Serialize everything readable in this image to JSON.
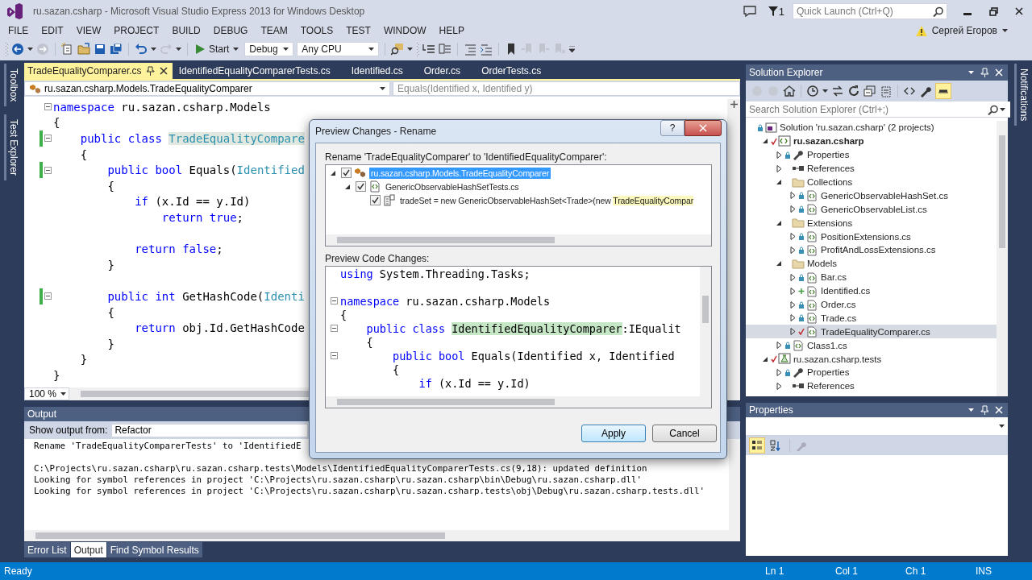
{
  "window": {
    "title": "ru.sazan.csharp - Microsoft Visual Studio Express 2013 for Windows Desktop"
  },
  "title_bar": {
    "notification_count": "1",
    "quick_launch": {
      "placeholder": "Quick Launch (Ctrl+Q)"
    },
    "user": "Сергей Егоров"
  },
  "menu": [
    "FILE",
    "EDIT",
    "VIEW",
    "PROJECT",
    "BUILD",
    "DEBUG",
    "TEAM",
    "TOOLS",
    "TEST",
    "WINDOW",
    "HELP"
  ],
  "toolbar": {
    "start": "Start",
    "configuration": "Debug",
    "platform": "Any CPU"
  },
  "side_tabs": [
    "Toolbox",
    "Test Explorer"
  ],
  "editor": {
    "tabs": [
      {
        "label": "TradeEqualityComparer.cs",
        "selected": true
      },
      {
        "label": "IdentifiedEqualityComparerTests.cs",
        "selected": false
      },
      {
        "label": "Identified.cs",
        "selected": false
      },
      {
        "label": "Order.cs",
        "selected": false
      },
      {
        "label": "OrderTests.cs",
        "selected": false
      }
    ],
    "nav_type": "ru.sazan.csharp.Models.TradeEqualityComparer",
    "nav_member": "Equals(Identified x, Identified y)",
    "lines": [
      {
        "segments": [
          {
            "kind": "keyword",
            "text": "namespace"
          },
          {
            "kind": "plain",
            "text": " ru.sazan.csharp.Models"
          }
        ],
        "collapsible": true,
        "changed": false
      },
      {
        "segments": [
          {
            "kind": "plain",
            "text": "{"
          }
        ],
        "collapsible": false,
        "changed": false
      },
      {
        "segments": [
          {
            "kind": "keyword",
            "text": "    public class "
          },
          {
            "kind": "rename",
            "text": "TradeEqualityCompare"
          }
        ],
        "collapsible": true,
        "changed": true
      },
      {
        "segments": [
          {
            "kind": "plain",
            "text": "    {"
          }
        ],
        "collapsible": false,
        "changed": false
      },
      {
        "segments": [
          {
            "kind": "keyword",
            "text": "        public bool"
          },
          {
            "kind": "plain",
            "text": " Equals("
          },
          {
            "kind": "type",
            "text": "Identified"
          }
        ],
        "collapsible": true,
        "changed": true
      },
      {
        "segments": [
          {
            "kind": "plain",
            "text": "        {"
          }
        ],
        "collapsible": false,
        "changed": false
      },
      {
        "segments": [
          {
            "kind": "keyword",
            "text": "            if"
          },
          {
            "kind": "plain",
            "text": " (x.Id == y.Id)"
          }
        ],
        "collapsible": false,
        "changed": false
      },
      {
        "segments": [
          {
            "kind": "keyword",
            "text": "                return true"
          },
          {
            "kind": "plain",
            "text": ";"
          }
        ],
        "collapsible": false,
        "changed": false
      },
      {
        "segments": [
          {
            "kind": "keyword",
            "text": "            return false"
          },
          {
            "kind": "plain",
            "text": ";"
          }
        ],
        "collapsible": false,
        "changed": false,
        "blank_before": true
      },
      {
        "segments": [
          {
            "kind": "plain",
            "text": "        }"
          }
        ],
        "collapsible": false,
        "changed": false
      },
      {
        "segments": [
          {
            "kind": "keyword",
            "text": "        public int"
          },
          {
            "kind": "plain",
            "text": " GetHashCode("
          },
          {
            "kind": "type",
            "text": "Identi"
          }
        ],
        "collapsible": true,
        "changed": true,
        "blank_before": true
      },
      {
        "segments": [
          {
            "kind": "plain",
            "text": "        {"
          }
        ],
        "collapsible": false,
        "changed": false
      },
      {
        "segments": [
          {
            "kind": "keyword",
            "text": "            return"
          },
          {
            "kind": "plain",
            "text": " obj.Id.GetHashCode"
          }
        ],
        "collapsible": false,
        "changed": false
      },
      {
        "segments": [
          {
            "kind": "plain",
            "text": "        }"
          }
        ],
        "collapsible": false,
        "changed": false
      },
      {
        "segments": [
          {
            "kind": "plain",
            "text": "    }"
          }
        ],
        "collapsible": false,
        "changed": false
      },
      {
        "segments": [
          {
            "kind": "plain",
            "text": "}"
          }
        ],
        "collapsible": false,
        "changed": false
      }
    ],
    "zoom": "100 %"
  },
  "dialog": {
    "title": "Preview Changes - Rename",
    "help_button": "?",
    "rename_label": "Rename 'TradeEqualityComparer' to 'IdentifiedEqualityComparer':",
    "tree": [
      {
        "label": "ru.sazan.csharp.Models.TradeEqualityComparer",
        "kind": "class",
        "checked": true,
        "expanded": true,
        "selected": true,
        "children": [
          {
            "label": "GenericObservableHashSetTests.cs",
            "kind": "file",
            "checked": true,
            "expanded": true,
            "selected": false,
            "children": [
              {
                "label": "tradeSet = new GenericObservableHashSet<Trade>(new ",
                "match": "TradeEqualityCompar",
                "kind": "reference",
                "checked": true,
                "selected": false
              }
            ]
          }
        ]
      }
    ],
    "preview_label": "Preview Code Changes:",
    "preview_lines": [
      {
        "segments": [
          {
            "kind": "keyword",
            "text": "using"
          },
          {
            "kind": "plain",
            "text": " System.Threading.Tasks;"
          }
        ],
        "collapsible": false
      },
      {
        "segments": [
          {
            "kind": "keyword",
            "text": "namespace"
          },
          {
            "kind": "plain",
            "text": " ru.sazan.csharp.Models"
          }
        ],
        "collapsible": true,
        "blank_before": true
      },
      {
        "segments": [
          {
            "kind": "plain",
            "text": "{"
          }
        ],
        "collapsible": false
      },
      {
        "segments": [
          {
            "kind": "keyword",
            "text": "    public class "
          },
          {
            "kind": "added",
            "text": "IdentifiedEqualityComparer"
          },
          {
            "kind": "plain",
            "text": ":IEqualit"
          }
        ],
        "collapsible": true
      },
      {
        "segments": [
          {
            "kind": "plain",
            "text": "    {"
          }
        ],
        "collapsible": false
      },
      {
        "segments": [
          {
            "kind": "keyword",
            "text": "        public bool"
          },
          {
            "kind": "plain",
            "text": " Equals(Identified x, Identified"
          }
        ],
        "collapsible": true
      },
      {
        "segments": [
          {
            "kind": "plain",
            "text": "        {"
          }
        ],
        "collapsible": false
      },
      {
        "segments": [
          {
            "kind": "keyword",
            "text": "            if"
          },
          {
            "kind": "plain",
            "text": " (x.Id == y.Id)"
          }
        ],
        "collapsible": false
      }
    ],
    "buttons": [
      {
        "label": "Apply",
        "default": true
      },
      {
        "label": "Cancel",
        "default": false
      }
    ]
  },
  "output": {
    "title": "Output",
    "source_label": "Show output from:",
    "source": "Refactor",
    "lines": [
      "Rename 'TradeEqualityComparerTests' to 'IdentifiedE",
      "C:\\Projects\\ru.sazan.csharp\\ru.sazan.csharp.tests\\Models\\IdentifiedEqualityComparerTests.cs(9,18): updated definition",
      "Looking for symbol references in project 'C:\\Projects\\ru.sazan.csharp\\ru.sazan.csharp\\bin\\Debug\\ru.sazan.csharp.dll'",
      "Looking for symbol references in project 'C:\\Projects\\ru.sazan.csharp\\ru.sazan.csharp.tests\\obj\\Debug\\ru.sazan.csharp.tests.dll'"
    ],
    "tabs": [
      {
        "label": "Error List",
        "selected": false
      },
      {
        "label": "Output",
        "selected": true
      },
      {
        "label": "Find Symbol Results",
        "selected": false
      }
    ]
  },
  "solution_explorer": {
    "title": "Solution Explorer",
    "preview_selected": true,
    "search": {
      "placeholder": "Search Solution Explorer (Ctrl+;)"
    },
    "tree": [
      {
        "label": "Solution 'ru.sazan.csharp' (2 projects)",
        "kind": "solution",
        "checked_in": true,
        "added": false,
        "modified": false,
        "selected": false,
        "children": [
          {
            "label": "ru.sazan.csharp",
            "kind": "project",
            "checked_in": false,
            "added": false,
            "modified": true,
            "startup": true,
            "expanded": true,
            "selected": false,
            "children": [
              {
                "label": "Properties",
                "kind": "properties",
                "checked_in": true,
                "added": false,
                "modified": false,
                "expanded": false,
                "selected": false
              },
              {
                "label": "References",
                "kind": "references",
                "checked_in": false,
                "added": false,
                "modified": false,
                "expanded": false,
                "selected": false
              },
              {
                "label": "Collections",
                "kind": "folder",
                "checked_in": false,
                "added": false,
                "modified": false,
                "expanded": true,
                "selected": false,
                "children": [
                  {
                    "label": "GenericObservableHashSet.cs",
                    "kind": "csharp",
                    "checked_in": true,
                    "added": false,
                    "modified": false,
                    "expanded": false,
                    "selected": false
                  },
                  {
                    "label": "GenericObservableList.cs",
                    "kind": "csharp",
                    "checked_in": true,
                    "added": false,
                    "modified": false,
                    "expanded": false,
                    "selected": false
                  }
                ]
              },
              {
                "label": "Extensions",
                "kind": "folder",
                "checked_in": false,
                "added": false,
                "modified": false,
                "expanded": true,
                "selected": false,
                "children": [
                  {
                    "label": "PositionExtensions.cs",
                    "kind": "csharp",
                    "checked_in": true,
                    "added": false,
                    "modified": false,
                    "expanded": false,
                    "selected": false
                  },
                  {
                    "label": "ProfitAndLossExtensions.cs",
                    "kind": "csharp",
                    "checked_in": true,
                    "added": false,
                    "modified": false,
                    "expanded": false,
                    "selected": false
                  }
                ]
              },
              {
                "label": "Models",
                "kind": "folder",
                "checked_in": false,
                "added": false,
                "modified": false,
                "expanded": true,
                "selected": false,
                "children": [
                  {
                    "label": "Bar.cs",
                    "kind": "csharp",
                    "checked_in": true,
                    "added": false,
                    "modified": false,
                    "expanded": false,
                    "selected": false
                  },
                  {
                    "label": "Identified.cs",
                    "kind": "csharp",
                    "checked_in": false,
                    "added": true,
                    "modified": false,
                    "expanded": false,
                    "selected": false
                  },
                  {
                    "label": "Order.cs",
                    "kind": "csharp",
                    "checked_in": true,
                    "added": false,
                    "modified": false,
                    "expanded": false,
                    "selected": false
                  },
                  {
                    "label": "Trade.cs",
                    "kind": "csharp",
                    "checked_in": true,
                    "added": false,
                    "modified": false,
                    "expanded": false,
                    "selected": false
                  },
                  {
                    "label": "TradeEqualityComparer.cs",
                    "kind": "csharp",
                    "checked_in": false,
                    "added": false,
                    "modified": true,
                    "expanded": false,
                    "selected": true
                  }
                ]
              },
              {
                "label": "Class1.cs",
                "kind": "csharp",
                "checked_in": true,
                "added": false,
                "modified": false,
                "expanded": false,
                "selected": false
              }
            ]
          },
          {
            "label": "ru.sazan.csharp.tests",
            "kind": "test-project",
            "checked_in": false,
            "added": false,
            "modified": true,
            "startup": false,
            "expanded": true,
            "selected": false,
            "children": [
              {
                "label": "Properties",
                "kind": "properties",
                "checked_in": true,
                "added": false,
                "modified": false,
                "expanded": false,
                "selected": false
              },
              {
                "label": "References",
                "kind": "references",
                "checked_in": false,
                "added": false,
                "modified": false,
                "expanded": false,
                "selected": false
              }
            ]
          }
        ]
      }
    ]
  },
  "properties": {
    "title": "Properties",
    "categorized": true
  },
  "notifications_tab": "Notifications",
  "status_bar": {
    "message": "Ready",
    "line": "Ln 1",
    "column": "Col 1",
    "char": "Ch 1",
    "mode": "INS"
  }
}
